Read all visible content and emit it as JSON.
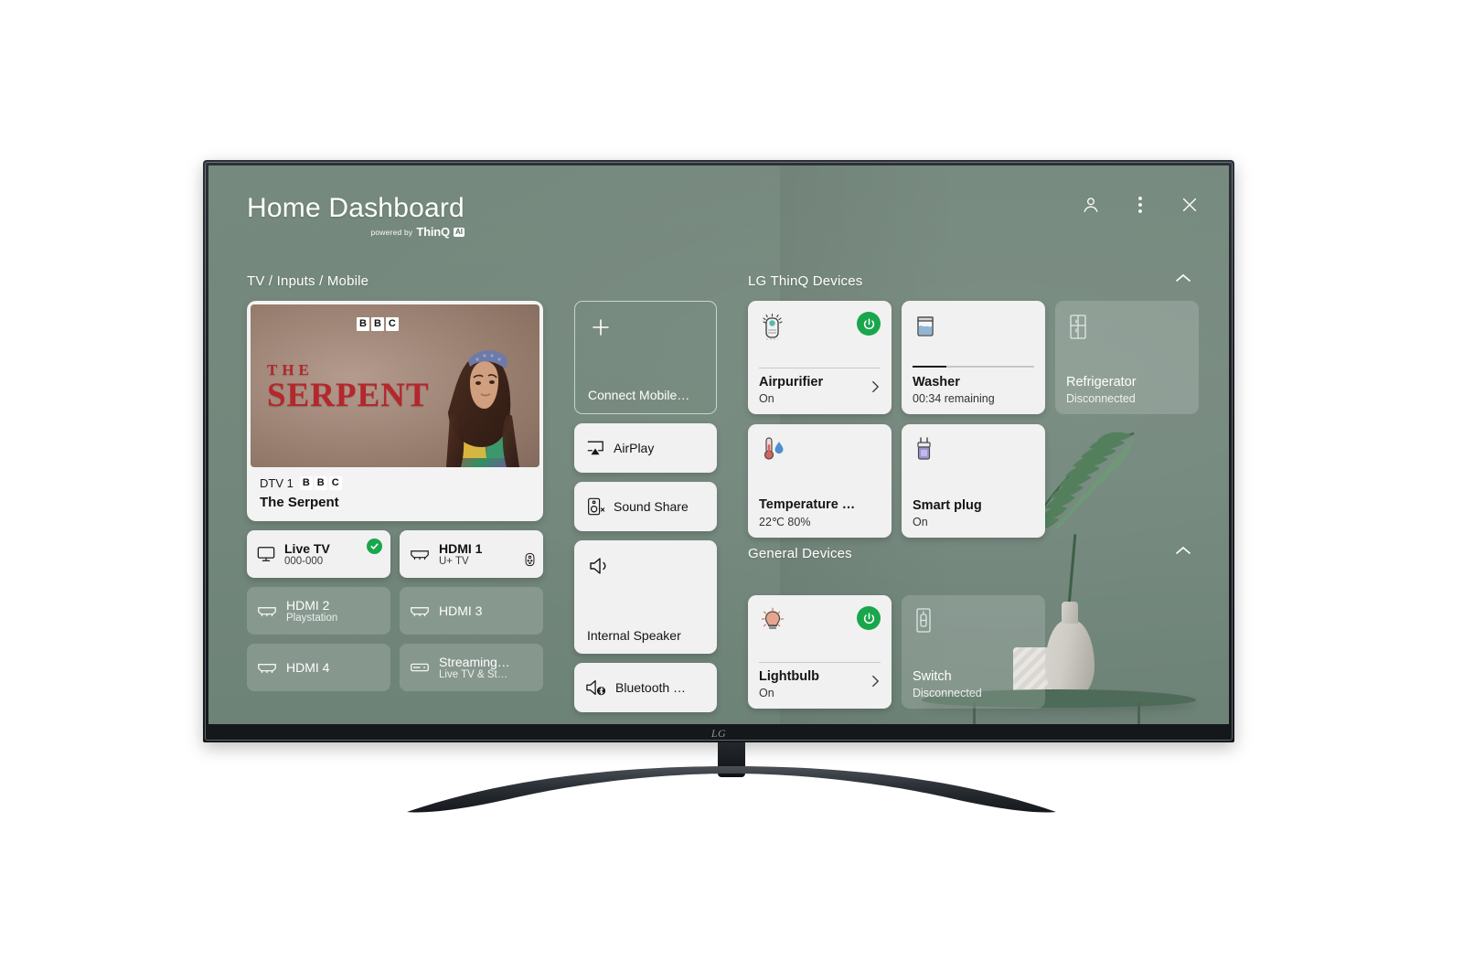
{
  "header": {
    "title": "Home Dashboard",
    "powered_by": "powered by",
    "brand": "ThinQ",
    "brand_badge": "AI",
    "actions": [
      {
        "name": "account-icon",
        "label": "Account"
      },
      {
        "name": "more-options-icon",
        "label": "More options"
      },
      {
        "name": "close-icon",
        "label": "Close"
      }
    ]
  },
  "sections": {
    "tv_inputs": "TV / Inputs / Mobile",
    "thinq_devices": "LG ThinQ Devices",
    "general_devices": "General Devices"
  },
  "preview": {
    "channel_prefix": "DTV 1",
    "broadcaster": [
      "B",
      "B",
      "C"
    ],
    "program_title": "The Serpent",
    "art_line1": "THE",
    "art_line2": "SERPENT"
  },
  "inputs": [
    {
      "name": "Live TV",
      "sub": "000-000",
      "icon": "tv-icon",
      "active": true,
      "selected": true,
      "badge": ""
    },
    {
      "name": "HDMI 1",
      "sub": "U+ TV",
      "icon": "hdmi-icon",
      "active": true,
      "selected": false,
      "badge": "remote-icon"
    },
    {
      "name": "HDMI 2",
      "sub": "Playstation",
      "icon": "hdmi-icon",
      "active": false,
      "selected": false,
      "badge": ""
    },
    {
      "name": "HDMI 3",
      "sub": "",
      "icon": "hdmi-icon",
      "active": false,
      "selected": false,
      "badge": ""
    },
    {
      "name": "HDMI 4",
      "sub": "",
      "icon": "hdmi-icon",
      "active": false,
      "selected": false,
      "badge": ""
    },
    {
      "name": "Streaming…",
      "sub": "Live TV & St…",
      "icon": "streaming-icon",
      "active": false,
      "selected": false,
      "badge": ""
    }
  ],
  "mobile": {
    "connect_label": "Connect Mobile…",
    "airplay_label": "AirPlay",
    "sound_share_label": "Sound Share",
    "internal_speaker_label": "Internal Speaker",
    "bluetooth_label": "Bluetooth …"
  },
  "thinq_devices": [
    {
      "name": "Airpurifier",
      "status": "On",
      "icon": "airpurifier-icon",
      "power": true,
      "connected": true,
      "chevron": true,
      "progress": null
    },
    {
      "name": "Washer",
      "status": "00:34 remaining",
      "icon": "washer-icon",
      "power": false,
      "connected": true,
      "chevron": false,
      "progress": 28
    },
    {
      "name": "Refrigerator",
      "status": "Disconnected",
      "icon": "refrigerator-icon",
      "power": false,
      "connected": false,
      "chevron": false,
      "progress": null
    },
    {
      "name": "Temperature hu…",
      "status": "22℃ 80%",
      "icon": "thermometer-icon",
      "power": false,
      "connected": true,
      "chevron": false,
      "progress": null
    },
    {
      "name": "Smart plug",
      "status": "On",
      "icon": "smartplug-icon",
      "power": false,
      "connected": true,
      "chevron": false,
      "progress": null
    }
  ],
  "general_devices": [
    {
      "name": "Lightbulb",
      "status": "On",
      "icon": "lightbulb-icon",
      "power": true,
      "connected": true,
      "chevron": true
    },
    {
      "name": "Switch",
      "status": "Disconnected",
      "icon": "switch-icon",
      "power": false,
      "connected": false,
      "chevron": false
    }
  ],
  "colors": {
    "screen_background": "#73877c",
    "card_background": "#f1f1f1",
    "accent_green": "#19a64c",
    "text_on_dark": "#ffffff",
    "text_on_card": "#151515",
    "thumb_title": "#b4272c"
  },
  "device_brand": "LG"
}
